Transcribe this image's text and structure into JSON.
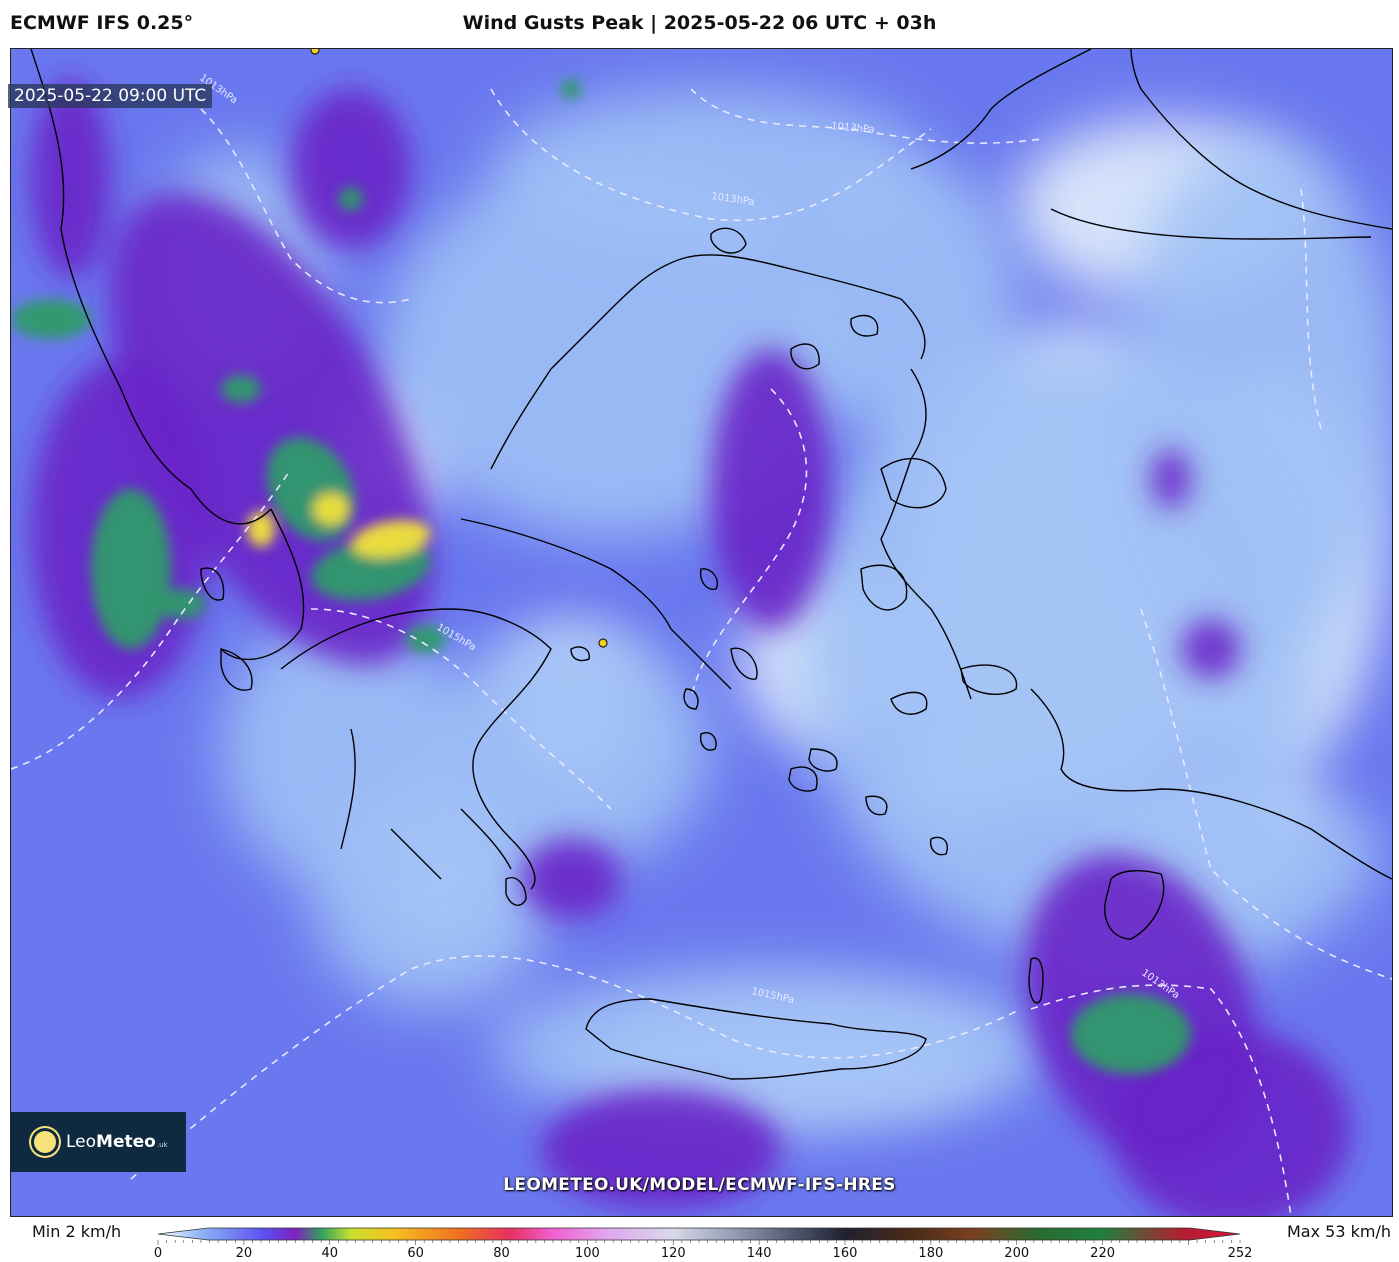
{
  "header": {
    "model": "ECMWF IFS 0.25°",
    "title": "Wind Gusts Peak | 2025-05-22 06 UTC + 03h"
  },
  "map": {
    "valid_time": "2025-05-22 09:00 UTC",
    "watermark": "LEOMETEO.UK/MODEL/ECMWF-IFS-HRES",
    "isobar_labels": [
      "1013hPa",
      "1013hPa",
      "1013hPa",
      "1015hPa",
      "1015hPa",
      "1013hPa"
    ],
    "colors": {
      "calm": "#dce9fb",
      "light": "#9fc0f5",
      "moderate": "#5a6cf0",
      "strong": "#6a22c8",
      "stronger": "#2e9a6a",
      "peak": "#f2e23a",
      "coastline": "#000000",
      "isobar": "#e8e8ff"
    }
  },
  "logo": {
    "brand_light": "Leo",
    "brand_bold": "Meteo",
    "suffix": ".uk"
  },
  "colorbar": {
    "min_label": "Min 2 km/h",
    "max_label": "Max 53 km/h",
    "ticks": [
      "0",
      "20",
      "40",
      "60",
      "80",
      "100",
      "120",
      "140",
      "160",
      "180",
      "200",
      "220",
      "252"
    ],
    "tick_values": [
      0,
      20,
      40,
      60,
      80,
      100,
      120,
      140,
      160,
      180,
      200,
      220,
      252
    ],
    "range": [
      0,
      252
    ],
    "stops": [
      {
        "v": 0,
        "c": "#ffffff"
      },
      {
        "v": 10,
        "c": "#8cb4f5"
      },
      {
        "v": 25,
        "c": "#5b4ef0"
      },
      {
        "v": 32,
        "c": "#8020c0"
      },
      {
        "v": 38,
        "c": "#30a060"
      },
      {
        "v": 45,
        "c": "#c8e030"
      },
      {
        "v": 55,
        "c": "#f5c020"
      },
      {
        "v": 70,
        "c": "#f07020"
      },
      {
        "v": 82,
        "c": "#e83060"
      },
      {
        "v": 92,
        "c": "#f060d0"
      },
      {
        "v": 105,
        "c": "#e0a8f0"
      },
      {
        "v": 120,
        "c": "#d8d8e8"
      },
      {
        "v": 135,
        "c": "#9098b0"
      },
      {
        "v": 148,
        "c": "#505870"
      },
      {
        "v": 160,
        "c": "#202030"
      },
      {
        "v": 175,
        "c": "#4a2a18"
      },
      {
        "v": 190,
        "c": "#7a4020"
      },
      {
        "v": 205,
        "c": "#2a6a30"
      },
      {
        "v": 220,
        "c": "#208040"
      },
      {
        "v": 238,
        "c": "#b02030"
      },
      {
        "v": 252,
        "c": "#e01040"
      }
    ]
  }
}
